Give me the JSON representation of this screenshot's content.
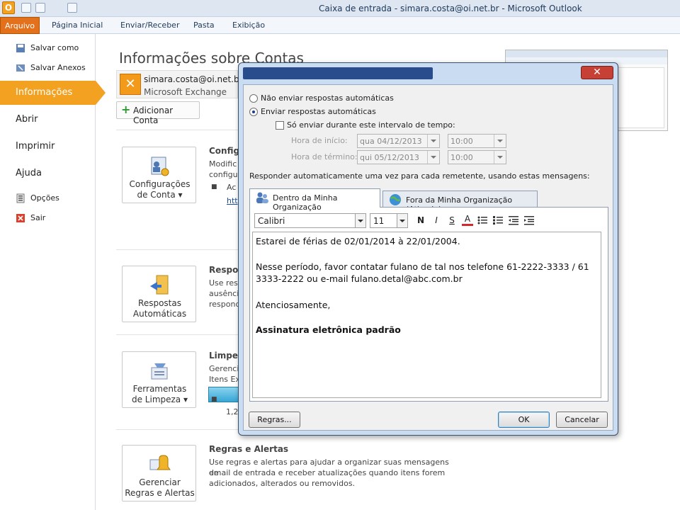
{
  "titlebar": {
    "title": "Caixa de entrada - simara.costa@oi.net.br - Microsoft Outlook"
  },
  "ribbon": {
    "tabs": [
      "Arquivo",
      "Página Inicial",
      "Enviar/Receber",
      "Pasta",
      "Exibição"
    ]
  },
  "leftnav": {
    "items": [
      {
        "label": "Salvar como"
      },
      {
        "label": "Salvar Anexos"
      },
      {
        "label": "Informações"
      },
      {
        "label": "Abrir"
      },
      {
        "label": "Imprimir"
      },
      {
        "label": "Ajuda"
      },
      {
        "label": "Opções"
      },
      {
        "label": "Sair"
      }
    ]
  },
  "main": {
    "heading": "Informações sobre Contas",
    "account": {
      "email": "simara.costa@oi.net.br",
      "type": "Microsoft Exchange"
    },
    "add_account": "Adicionar Conta",
    "sections": [
      {
        "button": [
          "Configurações",
          "de Conta ▾"
        ],
        "title": "Config",
        "text": [
          "Modific",
          "configu",
          "Ac",
          "htt"
        ]
      },
      {
        "button": [
          "Respostas",
          "Automáticas"
        ],
        "title": "Respos",
        "text": [
          "Use resp",
          "ausênci",
          "respond"
        ]
      },
      {
        "button": [
          "Ferramentas",
          "de Limpeza ▾"
        ],
        "title": "Limpez",
        "text": [
          "Gerenci",
          "Itens Ex",
          "1,2"
        ]
      },
      {
        "button": [
          "Gerenciar",
          "Regras e Alertas"
        ],
        "title": "Regras e Alertas",
        "text": [
          "Use regras e alertas para ajudar a organizar suas mensagens de",
          "email de entrada e receber atualizações quando itens forem",
          "adicionados, alterados ou removidos."
        ]
      }
    ]
  },
  "dialog": {
    "close_symbol": "✕",
    "radio_off": "Não enviar respostas automáticas",
    "radio_on": "Enviar respostas automáticas",
    "interval_checkbox": "Só enviar durante este intervalo de tempo:",
    "start_label": "Hora de início:",
    "end_label": "Hora de término:",
    "start_date": "qua 04/12/2013",
    "end_date": "qui 05/12/2013",
    "start_time": "10:00",
    "end_time": "10:00",
    "reply_label": "Responder automaticamente uma vez para cada remetente, usando estas mensagens:",
    "tab_inside": "Dentro da Minha Organização",
    "tab_outside": "Fora da Minha Organização (Ativado)",
    "font": "Calibri",
    "size": "11",
    "format_buttons": [
      "N",
      "I",
      "S",
      "A"
    ],
    "message_lines": [
      "Estarei de férias de 02/01/2014 à 22/01/2004.",
      "Nesse período, favor contatar fulano de tal nos telefone 61-2222-3333 / 61",
      "3333-2222 ou e-mail fulano.detal@abc.com.br",
      "Atenciosamente,",
      "Assinatura eletrônica padrão"
    ],
    "rules_button": "Regras...",
    "ok_button": "OK",
    "cancel_button": "Cancelar"
  }
}
